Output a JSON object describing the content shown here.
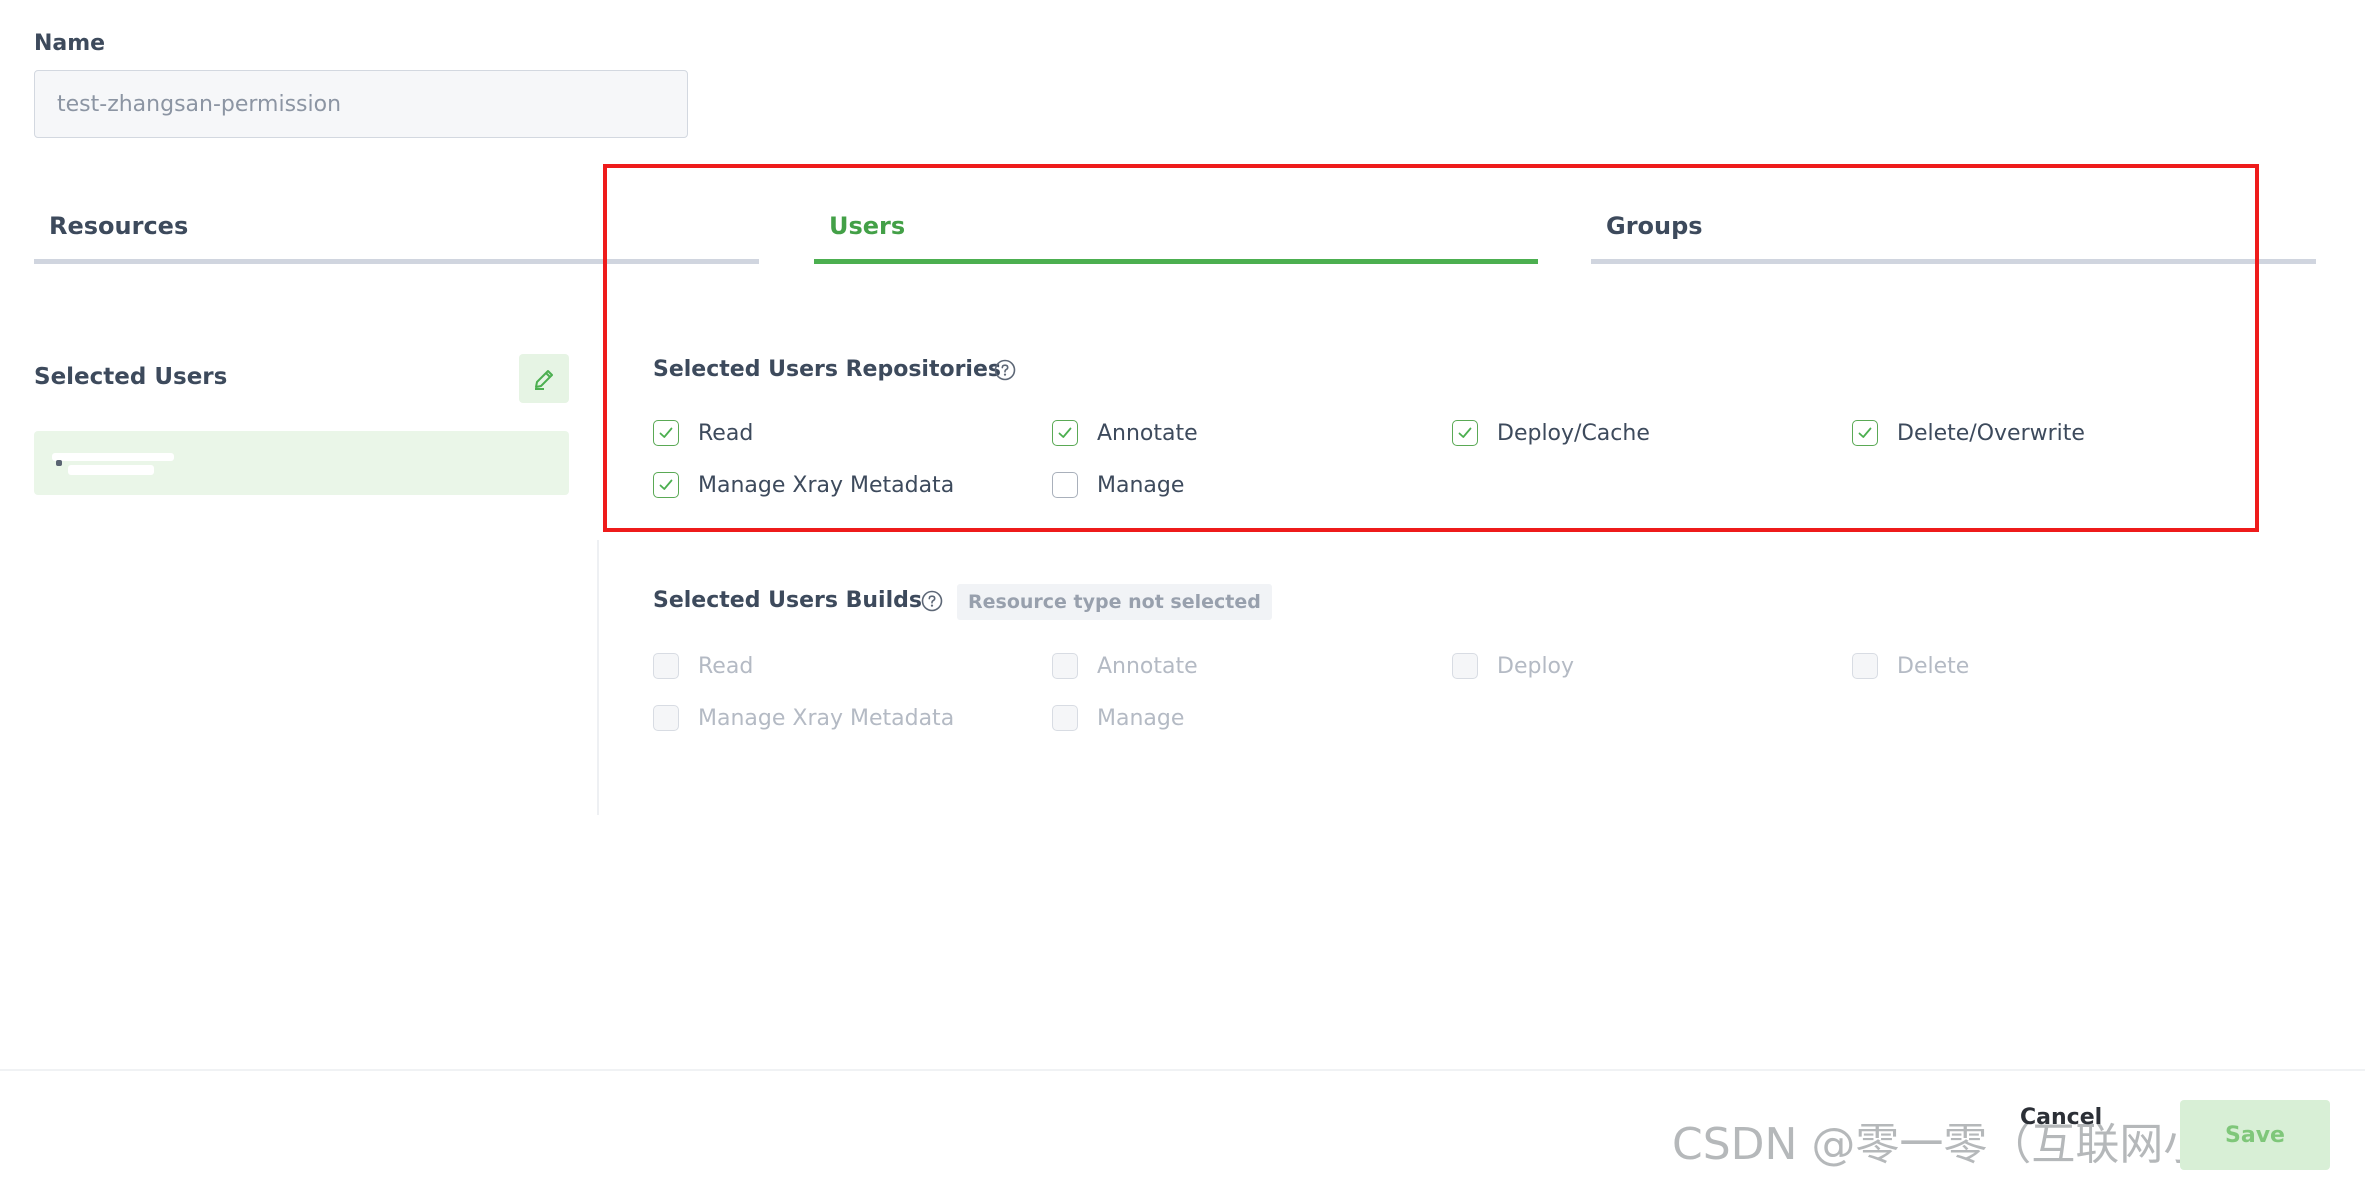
{
  "name": {
    "label": "Name",
    "value": "test-zhangsan-permission"
  },
  "tabs": [
    {
      "label": "Resources",
      "active": false
    },
    {
      "label": "Users",
      "active": true
    },
    {
      "label": "Groups",
      "active": false
    }
  ],
  "selected_users": {
    "title": "Selected Users",
    "edit_icon": "pencil-icon"
  },
  "repositories": {
    "title": "Selected Users Repositories",
    "help_icon": "question-circle-icon",
    "options": [
      {
        "label": "Read",
        "checked": true
      },
      {
        "label": "Annotate",
        "checked": true
      },
      {
        "label": "Deploy/Cache",
        "checked": true
      },
      {
        "label": "Delete/Overwrite",
        "checked": true
      },
      {
        "label": "Manage Xray Metadata",
        "checked": true
      },
      {
        "label": "Manage",
        "checked": false
      }
    ]
  },
  "builds": {
    "title": "Selected Users Builds",
    "help_icon": "question-circle-icon",
    "badge": "Resource type not selected",
    "options": [
      {
        "label": "Read",
        "checked": false
      },
      {
        "label": "Annotate",
        "checked": false
      },
      {
        "label": "Deploy",
        "checked": false
      },
      {
        "label": "Delete",
        "checked": false
      },
      {
        "label": "Manage Xray Metadata",
        "checked": false
      },
      {
        "label": "Manage",
        "checked": false
      }
    ]
  },
  "footer": {
    "cancel_label": "Cancel",
    "save_label": "Save"
  },
  "watermark": "CSDN @零一零（互联网小白版）",
  "colors": {
    "accent_green": "#4caf50",
    "highlight_red": "#ee1b1b",
    "tab_inactive": "#d0d5df"
  }
}
